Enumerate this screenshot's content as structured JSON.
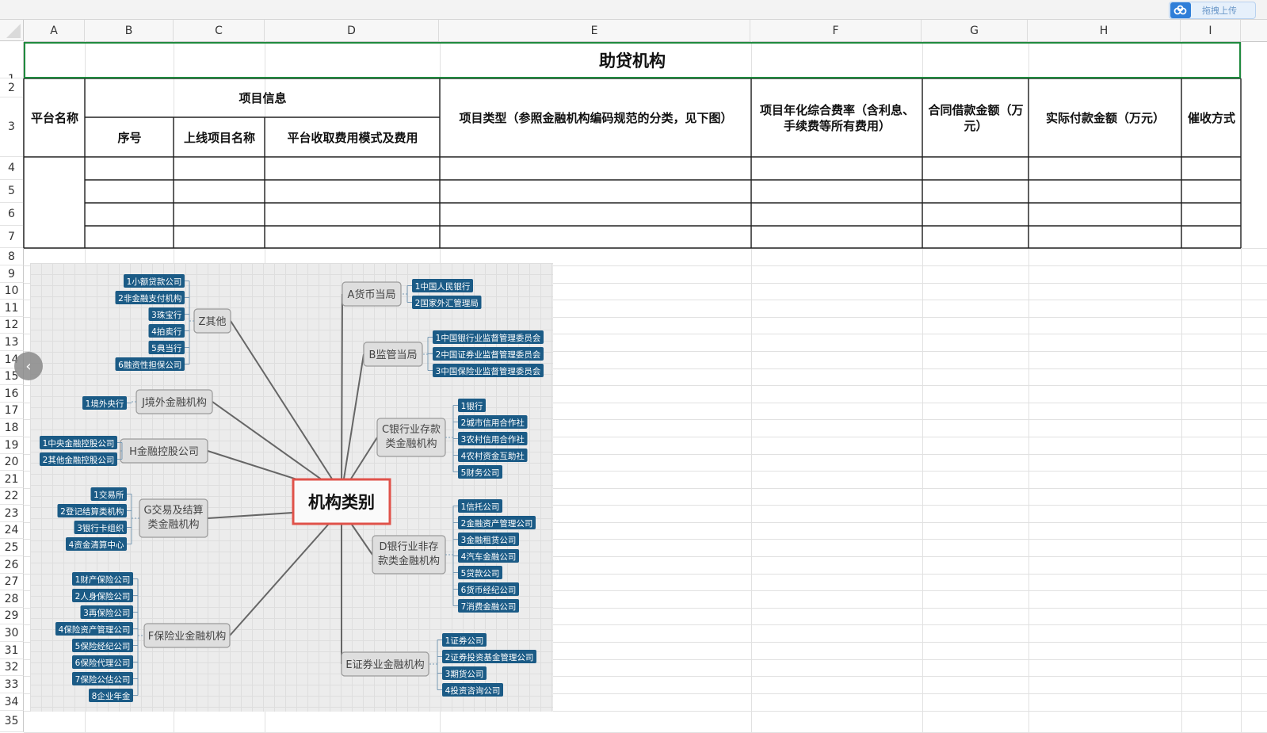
{
  "toolbar": {
    "upload_label": "拖拽上传"
  },
  "columns": [
    "A",
    "B",
    "C",
    "D",
    "E",
    "F",
    "G",
    "H",
    "I"
  ],
  "rows": [
    "1",
    "2",
    "3",
    "4",
    "5",
    "6",
    "7",
    "8",
    "9",
    "10",
    "11",
    "12",
    "13",
    "14",
    "15",
    "16",
    "17",
    "18",
    "19",
    "20",
    "21",
    "22",
    "23",
    "24",
    "25",
    "26",
    "27",
    "28",
    "29",
    "30",
    "31",
    "32",
    "33",
    "34",
    "35"
  ],
  "sheet": {
    "title": "助贷机构",
    "headers": {
      "platform_name": "平台名称",
      "project_info": "项目信息",
      "serial_no": "序号",
      "project_name": "上线项目名称",
      "fee_mode": "平台收取费用模式及费用",
      "project_type": "项目类型（参照金融机构编码规范的分类，见下图）",
      "annual_rate": "项目年化综合费率（含利息、手续费等所有费用）",
      "contract_amount": "合同借款金额（万元）",
      "actual_amount": "实际付款金额（万元）",
      "collection": "催收方式"
    }
  },
  "mindmap": {
    "center": "机构类别",
    "branches": [
      {
        "label": "Z其他",
        "items": [
          "1小额贷款公司",
          "2非金融支付机构",
          "3珠宝行",
          "4拍卖行",
          "5典当行",
          "6融资性担保公司"
        ]
      },
      {
        "label": "J境外金融机构",
        "items": [
          "1境外央行"
        ]
      },
      {
        "label": "H金融控股公司",
        "items": [
          "1中央金融控股公司",
          "2其他金融控股公司"
        ]
      },
      {
        "label": "G交易及结算类金融机构",
        "items": [
          "1交易所",
          "2登记结算类机构",
          "3银行卡组织",
          "4资金清算中心"
        ]
      },
      {
        "label": "F保险业金融机构",
        "items": [
          "1财产保险公司",
          "2人身保险公司",
          "3再保险公司",
          "4保险资产管理公司",
          "5保险经纪公司",
          "6保险代理公司",
          "7保险公估公司",
          "8企业年金"
        ]
      },
      {
        "label": "A货币当局",
        "items": [
          "1中国人民银行",
          "2国家外汇管理局"
        ]
      },
      {
        "label": "B监管当局",
        "items": [
          "1中国银行业监督管理委员会",
          "2中国证券业监督管理委员会",
          "3中国保险业监督管理委员会"
        ]
      },
      {
        "label": "C银行业存款类金融机构",
        "items": [
          "1银行",
          "2城市信用合作社",
          "3农村信用合作社",
          "4农村资金互助社",
          "5财务公司"
        ]
      },
      {
        "label": "D银行业非存款类金融机构",
        "items": [
          "1信托公司",
          "2金融资产管理公司",
          "3金融租赁公司",
          "4汽车金融公司",
          "5贷款公司",
          "6货币经纪公司",
          "7消费金融公司"
        ]
      },
      {
        "label": "E证券业金融机构",
        "items": [
          "1证券公司",
          "2证券投资基金管理公司",
          "3期货公司",
          "4投资咨询公司"
        ]
      }
    ]
  },
  "colors": {
    "accent_green": "#1f8a3e",
    "leaf_blue": "#1b5b86",
    "center_red": "#e0524a"
  }
}
